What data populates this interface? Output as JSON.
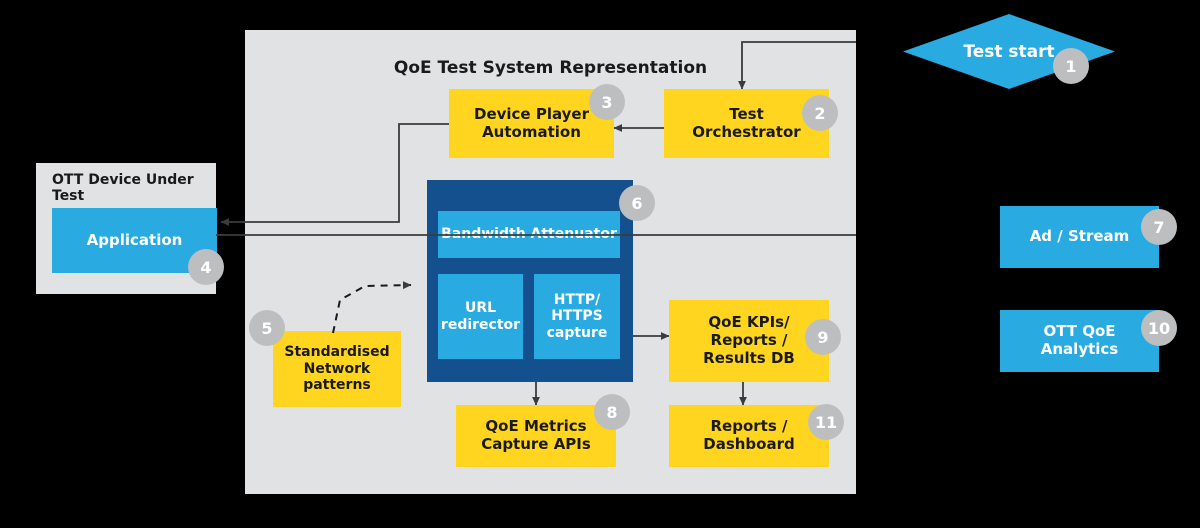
{
  "diagram": {
    "title": "QoE Test System Representation",
    "background_color": "#000000",
    "panel_color": "#e1e2e4",
    "colors": {
      "yellow": "#ffd520",
      "blue_light": "#29abe2",
      "blue_dark": "#14508d",
      "badge_gray": "#bcbec0",
      "line": "#3b3b3b",
      "text_dark": "#1a1a1a",
      "text_light": "#ffffff"
    }
  },
  "left_panel": {
    "title": "OTT Device Under Test",
    "application": {
      "label": "Application",
      "badge": "4"
    }
  },
  "main_panel": {
    "title": "QoE Test System Representation",
    "nodes": {
      "device_player_automation": {
        "label": "Device Player\nAutomation",
        "badge": "3"
      },
      "test_orchestrator": {
        "label": "Test\nOrchestrator",
        "badge": "2"
      },
      "proxy_container": {
        "badge": "6"
      },
      "bandwidth_attenuator": {
        "label": "Bandwidth Attenuator"
      },
      "url_redirector": {
        "label": "URL\nredirector"
      },
      "http_https_capture": {
        "label": "HTTP/\nHTTPS\ncapture"
      },
      "standardised_network_patterns": {
        "label": "Standardised\nNetwork\npatterns",
        "badge": "5"
      },
      "qoe_metrics_capture_apis": {
        "label": "QoE Metrics\nCapture APIs",
        "badge": "8"
      },
      "qoe_kpis_reports_results_db": {
        "label": "QoE KPIs/\nReports /\nResults DB",
        "badge": "9"
      },
      "reports_dashboard": {
        "label": "Reports /\nDashboard",
        "badge": "11"
      }
    }
  },
  "right_column": {
    "test_start": {
      "label": "Test start",
      "badge": "1"
    },
    "ad_stream": {
      "label": "Ad / Stream",
      "badge": "7"
    },
    "ott_qoe_analytics": {
      "label": "OTT QoE\nAnalytics",
      "badge": "10"
    }
  }
}
